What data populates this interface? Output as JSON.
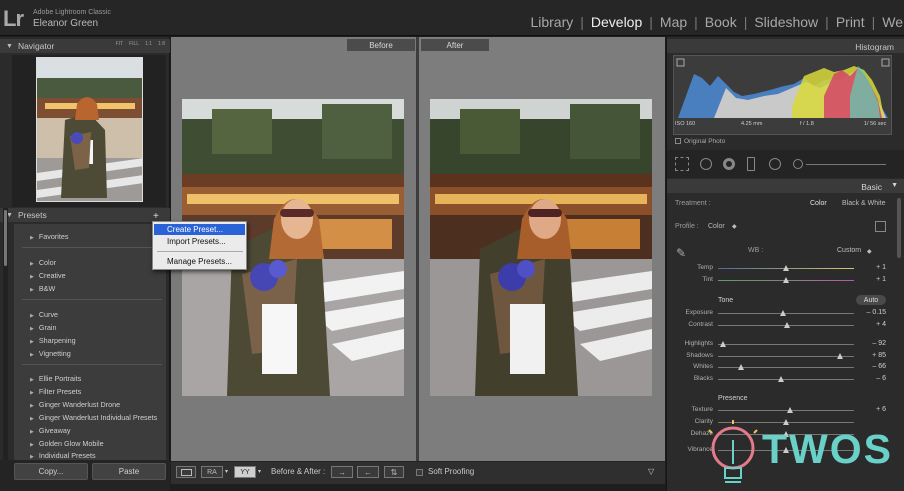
{
  "app": {
    "logo_text": "Lr",
    "app_name": "Adobe Lightroom Classic",
    "user_name": "Eleanor Green"
  },
  "modules": [
    {
      "label": "Library",
      "active": false
    },
    {
      "label": "Develop",
      "active": true
    },
    {
      "label": "Map",
      "active": false
    },
    {
      "label": "Book",
      "active": false
    },
    {
      "label": "Slideshow",
      "active": false
    },
    {
      "label": "Print",
      "active": false
    },
    {
      "label": "We",
      "active": false
    }
  ],
  "module_separator": "|",
  "navigator": {
    "title": "Navigator",
    "zoom_fit": "FIT",
    "zoom_fill": "FILL",
    "zoom_1": "1:1",
    "zoom_custom": "1:8"
  },
  "presets": {
    "title": "Presets",
    "add_icon": "+",
    "groups": [
      "Favorites",
      "Color",
      "Creative",
      "B&W",
      "Curve",
      "Grain",
      "Sharpening",
      "Vignetting",
      "Ellie Portraits",
      "Filter Presets",
      "Ginger Wanderlust Drone",
      "Ginger Wanderlust Individual Presets",
      "Giveaway",
      "Golden Glow Mobile",
      "Individual Presets"
    ]
  },
  "context_menu": {
    "items": [
      "Create Preset...",
      "Import Presets...",
      "Manage Presets..."
    ],
    "highlighted_index": 0
  },
  "left_buttons": {
    "copy": "Copy...",
    "paste": "Paste"
  },
  "compare": {
    "before_label": "Before",
    "after_label": "After"
  },
  "toolbar": {
    "ba_label": "Before & After :",
    "soft_proofing": "Soft Proofing",
    "view_ra": "RA",
    "view_yy": "YY"
  },
  "histogram": {
    "title": "Histogram",
    "iso": "ISO 160",
    "focal": "4.25 mm",
    "aperture": "f / 1.8",
    "shutter": "1/ 56 sec",
    "original_photo": "Original Photo"
  },
  "basic": {
    "title": "Basic",
    "treatment_label": "Treatment :",
    "treatment_color": "Color",
    "treatment_bw": "Black & White",
    "profile_label": "Profile :",
    "profile_value": "Color",
    "wb_label": "WB :",
    "wb_value": "Custom",
    "tone_label": "Tone",
    "auto_label": "Auto",
    "presence_label": "Presence",
    "sliders": [
      {
        "label": "Temp",
        "value": "+ 1",
        "pos": 0.5
      },
      {
        "label": "Tint",
        "value": "+ 1",
        "pos": 0.5
      },
      {
        "label": "Exposure",
        "value": "– 0.15",
        "pos": 0.48
      },
      {
        "label": "Contrast",
        "value": "+ 4",
        "pos": 0.51
      },
      {
        "label": "Highlights",
        "value": "– 92",
        "pos": 0.04
      },
      {
        "label": "Shadows",
        "value": "+ 85",
        "pos": 0.9
      },
      {
        "label": "Whites",
        "value": "– 66",
        "pos": 0.17
      },
      {
        "label": "Blacks",
        "value": "– 6",
        "pos": 0.47
      },
      {
        "label": "Texture",
        "value": "+ 6",
        "pos": 0.53
      },
      {
        "label": "Clarity",
        "value": "",
        "pos": 0.5
      },
      {
        "label": "Dehaze",
        "value": "",
        "pos": 0.5
      },
      {
        "label": "Vibrance",
        "value": "",
        "pos": 0.5
      }
    ]
  },
  "watermark": {
    "text": "TWOS"
  },
  "colors": {
    "accent_highlight": "#2a63d8",
    "watermark": "#6ad1c8"
  }
}
